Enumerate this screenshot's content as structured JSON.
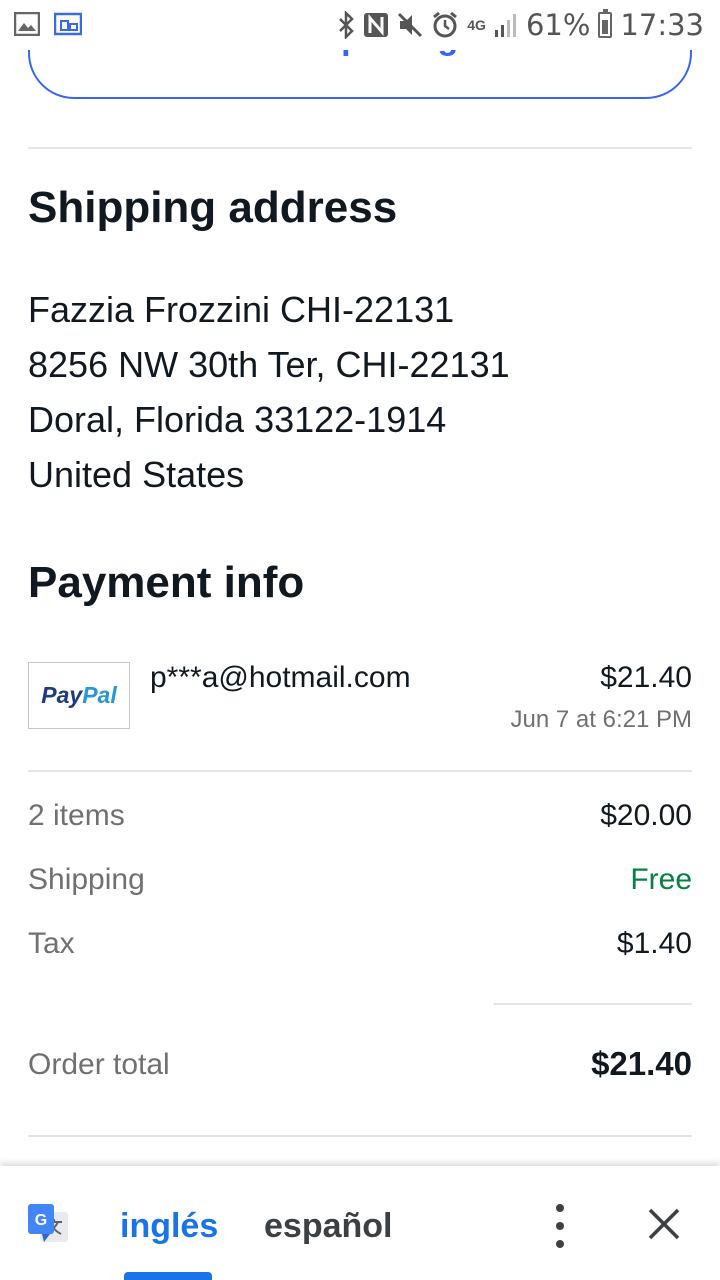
{
  "status_bar": {
    "battery_percent": "61%",
    "time": "17:33",
    "network_label": "4G",
    "icons": [
      "image-icon",
      "cast-icon",
      "bluetooth-icon",
      "nfc-icon",
      "mute-icon",
      "alarm-icon",
      "network-4g-icon",
      "signal-icon",
      "battery-icon"
    ]
  },
  "track_package": {
    "label": "Track package"
  },
  "shipping": {
    "title": "Shipping address",
    "lines": [
      "Fazzia Frozzini CHI-22131",
      "8256 NW 30th Ter, CHI-22131",
      "Doral, Florida 33122-1914",
      "United States"
    ]
  },
  "payment": {
    "title": "Payment info",
    "method_logo": {
      "part1": "Pay",
      "part2": "Pal"
    },
    "email": "p***a@hotmail.com",
    "amount": "$21.40",
    "date": "Jun 7 at 6:21 PM"
  },
  "summary": {
    "rows": [
      {
        "label": "2 items",
        "value": "$20.00"
      },
      {
        "label": "Shipping",
        "value": "Free"
      },
      {
        "label": "Tax",
        "value": "$1.40"
      }
    ],
    "total_label": "Order total",
    "total_value": "$21.40"
  },
  "translate_bar": {
    "source_language": "inglés",
    "target_language": "español"
  },
  "colors": {
    "accent_blue": "#3665f3",
    "free_green": "#05823f",
    "translate_blue": "#1a73e8"
  }
}
